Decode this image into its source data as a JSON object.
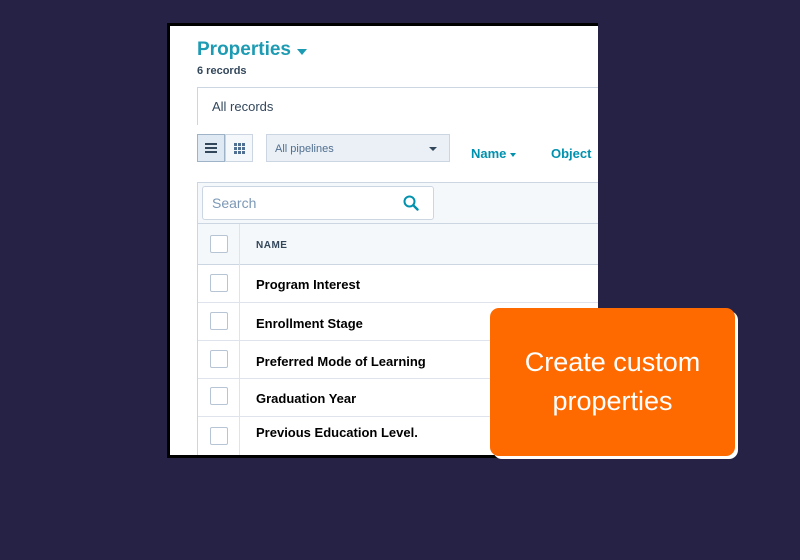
{
  "header": {
    "title": "Properties",
    "subtitle": "6 records"
  },
  "tabs": [
    {
      "label": "All records"
    }
  ],
  "toolbar": {
    "pipeline_select": "All pipelines",
    "filters": [
      {
        "label": "Name"
      },
      {
        "label": "Object"
      }
    ]
  },
  "search": {
    "placeholder": "Search"
  },
  "table": {
    "column_name": "NAME",
    "rows": [
      {
        "name": "Program Interest"
      },
      {
        "name": "Enrollment Stage"
      },
      {
        "name": "Preferred Mode of Learning"
      },
      {
        "name": "Graduation Year"
      },
      {
        "name": "Previous Education Level."
      }
    ]
  },
  "callout": {
    "text": "Create custom properties"
  },
  "colors": {
    "background": "#262245",
    "accent": "#1d9bb3",
    "callout": "#ff6a00"
  },
  "icons": {
    "list_view": "list-icon",
    "grid_view": "grid-icon",
    "search": "search-icon",
    "dropdown": "caret-down-icon"
  }
}
